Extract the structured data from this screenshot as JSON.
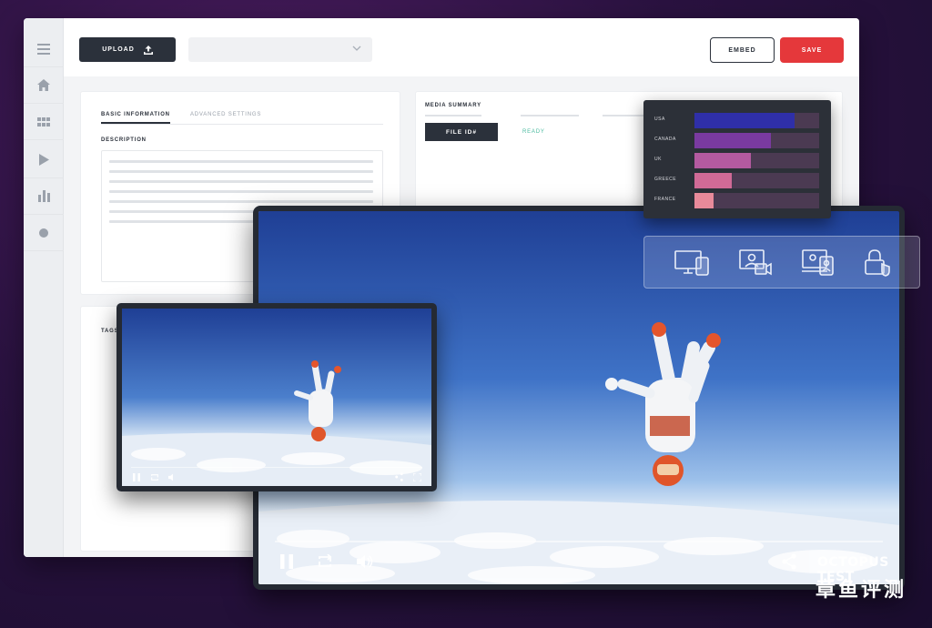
{
  "toolbar": {
    "upload_label": "UPLOAD",
    "embed_label": "EMBED",
    "save_label": "SAVE",
    "select_value": ""
  },
  "sidebar": {
    "items": [
      {
        "name": "menu",
        "icon": "hamburger-icon"
      },
      {
        "name": "home",
        "icon": "home-icon"
      },
      {
        "name": "library",
        "icon": "grid-icon"
      },
      {
        "name": "videos",
        "icon": "play-icon"
      },
      {
        "name": "analytics",
        "icon": "bar-chart-icon"
      },
      {
        "name": "settings",
        "icon": "dot-icon"
      }
    ]
  },
  "info_panel": {
    "tabs": [
      {
        "label": "BASIC INFORMATION",
        "active": true
      },
      {
        "label": "ADVANCED SETTINGS",
        "active": false
      }
    ],
    "description_label": "DESCRIPTION",
    "tags_label": "TAGS"
  },
  "media_summary": {
    "title": "MEDIA SUMMARY",
    "file_id_label": "FILE ID#",
    "status": "READY"
  },
  "chart_data": {
    "type": "bar",
    "orientation": "horizontal",
    "categories": [
      "USA",
      "CANADA",
      "UK",
      "GREECE",
      "FRANCE"
    ],
    "values": [
      80,
      61,
      45,
      30,
      15
    ],
    "xlim": [
      0,
      100
    ],
    "colors": [
      "#2f2fa8",
      "#7a3aa0",
      "#b45aa0",
      "#d06a96",
      "#e88a9a"
    ],
    "track_color": "#4b3a52",
    "grid": false
  },
  "features": [
    {
      "icon": "multi-device-icon"
    },
    {
      "icon": "video-call-icon"
    },
    {
      "icon": "presenter-screen-icon"
    },
    {
      "icon": "secure-lock-icon"
    }
  ],
  "player": {
    "controls": [
      "pause-icon",
      "loop-icon",
      "volume-icon",
      "share-icon"
    ]
  },
  "watermark": {
    "en": "OCTOPUS TEST",
    "cn": "章鱼评测"
  },
  "colors": {
    "accent": "#e5383b",
    "dark": "#2b313b",
    "ready": "#4cbba0"
  }
}
